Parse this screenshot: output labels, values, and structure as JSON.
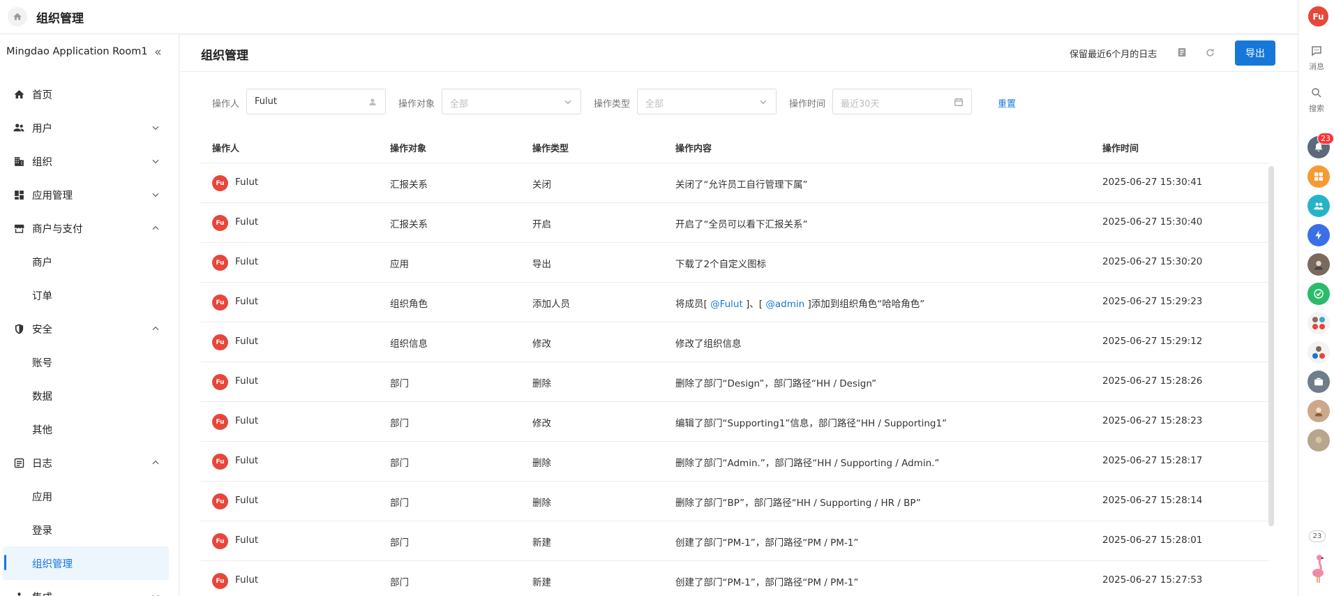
{
  "topbar": {
    "title": "组织管理"
  },
  "sidebar": {
    "org_name": "Mingdao Application Room1",
    "items": [
      {
        "label": "首页",
        "icon": "home-icon",
        "chevron": ""
      },
      {
        "label": "用户",
        "icon": "users-icon",
        "chevron": "down"
      },
      {
        "label": "组织",
        "icon": "building-icon",
        "chevron": "down"
      },
      {
        "label": "应用管理",
        "icon": "apps-icon",
        "chevron": "down"
      },
      {
        "label": "商户与支付",
        "icon": "store-icon",
        "chevron": "up"
      },
      {
        "label": "商户"
      },
      {
        "label": "订单"
      },
      {
        "label": "安全",
        "icon": "shield-icon",
        "chevron": "up"
      },
      {
        "label": "账号"
      },
      {
        "label": "数据"
      },
      {
        "label": "其他"
      },
      {
        "label": "日志",
        "icon": "log-icon",
        "chevron": "up"
      },
      {
        "label": "应用"
      },
      {
        "label": "登录"
      },
      {
        "label": "组织管理",
        "active": true
      },
      {
        "label": "集成",
        "icon": "integration-icon",
        "chevron": "down"
      }
    ]
  },
  "header": {
    "title": "组织管理",
    "retention": "保留最近6个月的日志",
    "export_label": "导出"
  },
  "filters": {
    "operator_label": "操作人",
    "operator_value": "Fulut",
    "target_label": "操作对象",
    "target_placeholder": "全部",
    "type_label": "操作类型",
    "type_placeholder": "全部",
    "time_label": "操作时间",
    "time_placeholder": "最近30天",
    "reset_label": "重置"
  },
  "table": {
    "columns": [
      "操作人",
      "操作对象",
      "操作类型",
      "操作内容",
      "操作时间"
    ],
    "rows": [
      {
        "avatar": "Fu",
        "user": "Fulut",
        "target": "汇报关系",
        "type": "关闭",
        "content": "关闭了“允许员工自行管理下属”",
        "time": "2025-06-27 15:30:41"
      },
      {
        "avatar": "Fu",
        "user": "Fulut",
        "target": "汇报关系",
        "type": "开启",
        "content": "开启了“全员可以看下汇报关系”",
        "time": "2025-06-27 15:30:40"
      },
      {
        "avatar": "Fu",
        "user": "Fulut",
        "target": "应用",
        "type": "导出",
        "content": "下载了2个自定义图标",
        "time": "2025-06-27 15:30:20"
      },
      {
        "avatar": "Fu",
        "user": "Fulut",
        "target": "组织角色",
        "type": "添加人员",
        "content_pre": "将成员[ ",
        "mention1": "@Fulut",
        "content_mid": " ]、[ ",
        "mention2": "@admin",
        "content_post": " ]添加到组织角色“哈哈角色”",
        "time": "2025-06-27 15:29:23"
      },
      {
        "avatar": "Fu",
        "user": "Fulut",
        "target": "组织信息",
        "type": "修改",
        "content": "修改了组织信息",
        "time": "2025-06-27 15:29:12"
      },
      {
        "avatar": "Fu",
        "user": "Fulut",
        "target": "部门",
        "type": "删除",
        "content": "删除了部门“Design”，部门路径“HH / Design”",
        "time": "2025-06-27 15:28:26"
      },
      {
        "avatar": "Fu",
        "user": "Fulut",
        "target": "部门",
        "type": "修改",
        "content": "编辑了部门“Supporting1”信息，部门路径“HH / Supporting1”",
        "time": "2025-06-27 15:28:23"
      },
      {
        "avatar": "Fu",
        "user": "Fulut",
        "target": "部门",
        "type": "删除",
        "content": "删除了部门“Admin.”，部门路径“HH / Supporting / Admin.”",
        "time": "2025-06-27 15:28:17"
      },
      {
        "avatar": "Fu",
        "user": "Fulut",
        "target": "部门",
        "type": "删除",
        "content": "删除了部门“BP”，部门路径“HH / Supporting / HR / BP”",
        "time": "2025-06-27 15:28:14"
      },
      {
        "avatar": "Fu",
        "user": "Fulut",
        "target": "部门",
        "type": "新建",
        "content": "创建了部门“PM-1”，部门路径“PM / PM-1”",
        "time": "2025-06-27 15:28:01"
      },
      {
        "avatar": "Fu",
        "user": "Fulut",
        "target": "部门",
        "type": "新建",
        "content": "创建了部门“PM-1”，部门路径“PM / PM-1”",
        "time": "2025-06-27 15:27:53"
      }
    ]
  },
  "rail": {
    "user_avatar": "Fu",
    "messages_label": "消息",
    "search_label": "搜索",
    "notification_badge": "23",
    "bottom_count": "23"
  },
  "colors": {
    "accent": "#1677d9",
    "avatar_red": "#e8463a"
  }
}
